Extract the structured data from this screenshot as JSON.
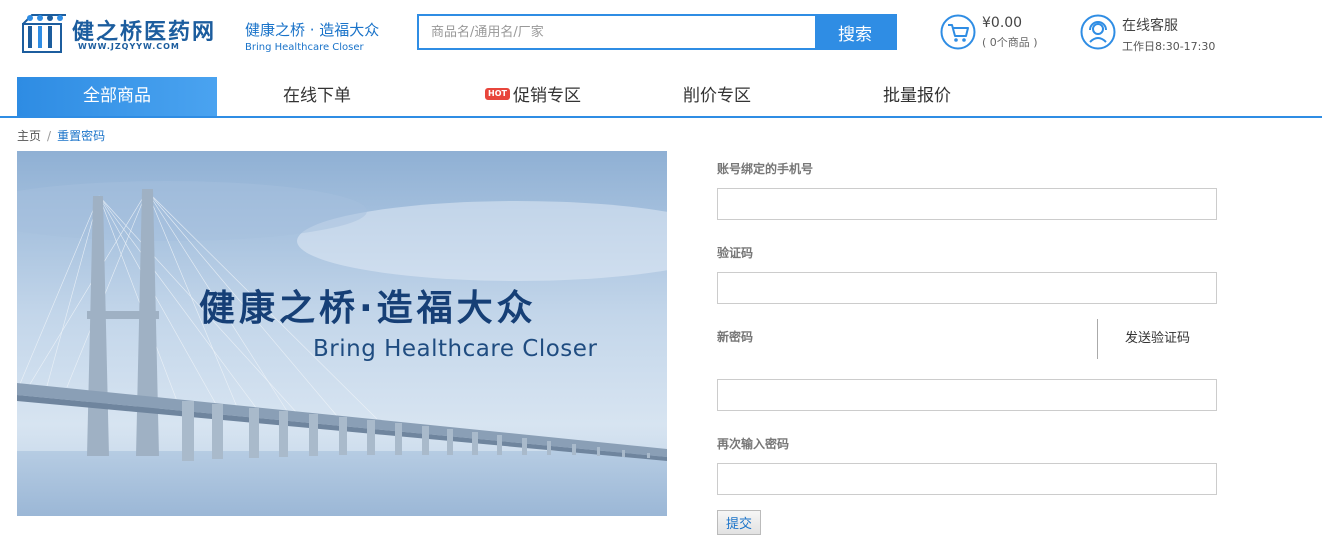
{
  "header": {
    "logo_name": "健之桥医药网",
    "logo_url": "WWW.JZQYYW.COM",
    "slogan_cn": "健康之桥 · 造福大众",
    "slogan_en": "Bring Healthcare Closer",
    "search_placeholder": "商品名/通用名/厂家",
    "search_button": "搜索",
    "cart_price": "¥0.00",
    "cart_count": "( 0个商品 )",
    "service_title": "在线客服",
    "service_hours": "工作日8:30-17:30"
  },
  "nav": {
    "items": [
      {
        "label": "全部商品",
        "active": true
      },
      {
        "label": "在线下单"
      },
      {
        "label": "促销专区",
        "badge": "HOT"
      },
      {
        "label": "削价专区"
      },
      {
        "label": "批量报价"
      }
    ]
  },
  "breadcrumb": {
    "home": "主页",
    "separator": "/",
    "current": "重置密码"
  },
  "banner": {
    "title_cn": "健康之桥·造福大众",
    "title_en": "Bring Healthcare Closer"
  },
  "form": {
    "phone_label": "账号绑定的手机号",
    "code_label": "验证码",
    "new_password_label": "新密码",
    "send_code_button": "发送验证码",
    "confirm_password_label": "再次输入密码",
    "submit_button": "提交"
  },
  "colors": {
    "primary": "#2f8de4",
    "brand_dark": "#1c5d9e",
    "hot_badge": "#e8463c"
  }
}
